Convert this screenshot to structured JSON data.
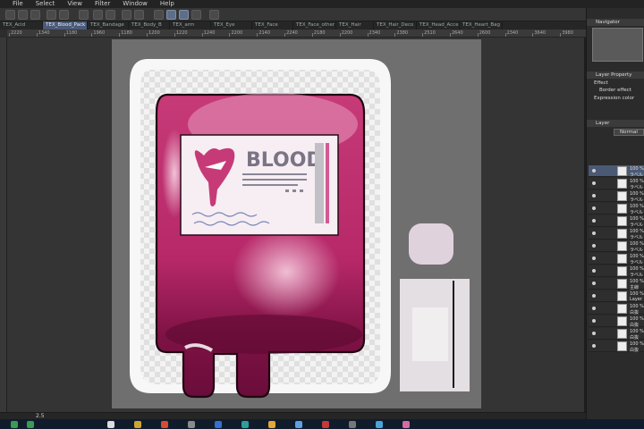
{
  "menu": [
    "File",
    "Select",
    "View",
    "Filter",
    "Window",
    "Help"
  ],
  "tabs": [
    "TEX_Acid",
    "TEX_Blood_Pack",
    "TEX_Bandage",
    "TEX_Body_B",
    "TEX_arm",
    "TEX_Eye",
    "TEX_Face",
    "TEX_Face_other",
    "TEX_Hair",
    "TEX_Hair_Deco",
    "TEX_Head_Acce",
    "TEX_Heart_Bag"
  ],
  "ruler_labels": [
    "2220",
    "1340",
    "1180",
    "1960",
    "1180",
    "1200",
    "1220",
    "1240",
    "2200",
    "2140",
    "2240",
    "2180",
    "2200",
    "2340",
    "2380",
    "2510",
    "2640",
    "2600",
    "2340",
    "3640",
    "3980"
  ],
  "blood_label": "BLOOD",
  "status": {
    "zoom": "2.5"
  },
  "panels": {
    "navigator": "Navigator",
    "layer_property": "Layer Property",
    "effect": "Effect",
    "border_effect": "Border effect",
    "expression_color": "Expression color",
    "layer": "Layer",
    "blend_mode": "Normal"
  },
  "layers": [
    {
      "pct": "100 %",
      "name": "ラベル"
    },
    {
      "pct": "100 %",
      "name": "ラベル"
    },
    {
      "pct": "100 %",
      "name": "ラベル"
    },
    {
      "pct": "100 %",
      "name": "ラベル"
    },
    {
      "pct": "100 %",
      "name": "ラベル"
    },
    {
      "pct": "100 %",
      "name": "ラベル"
    },
    {
      "pct": "100 %",
      "name": "ラベル"
    },
    {
      "pct": "100 %",
      "name": "ラベル"
    },
    {
      "pct": "100 %",
      "name": "ラベル Co"
    },
    {
      "pct": "100 %",
      "name": "主線"
    },
    {
      "pct": "100 %",
      "name": "Layer"
    },
    {
      "pct": "100 %",
      "name": "白抜"
    },
    {
      "pct": "100 %",
      "name": "白抜"
    },
    {
      "pct": "100 %",
      "name": "白抜"
    },
    {
      "pct": "100 %",
      "name": "白抜"
    }
  ],
  "colors": {
    "blood": "#b8286a",
    "blood_dark": "#6e0f3a",
    "bag_white": "#f4f4f4",
    "label_bg": "#f6eef2"
  }
}
